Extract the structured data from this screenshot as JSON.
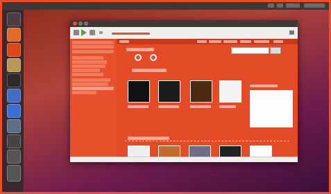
{
  "desktop": {
    "top_bar_title": ""
  },
  "player": {
    "window_title": "",
    "status_text": "",
    "sidebar_items": [
      "",
      "",
      "",
      "",
      "",
      "",
      "",
      "",
      "",
      "",
      "",
      ""
    ],
    "store_heading": "",
    "section_heading": "",
    "latest_heading": "",
    "search_button": "",
    "nav_tabs": [
      "",
      "",
      "",
      "",
      "",
      ""
    ],
    "featured_albums": [
      {
        "caption": ""
      },
      {
        "caption": ""
      },
      {
        "caption": ""
      },
      {
        "caption": ""
      }
    ],
    "chart_entries": [
      "",
      "",
      "",
      "",
      "",
      "",
      "",
      ""
    ],
    "latest_albums": [
      {
        "caption": ""
      },
      {
        "caption": ""
      },
      {
        "caption": ""
      },
      {
        "caption": ""
      },
      {
        "caption": ""
      }
    ]
  },
  "colors": {
    "accent": "#e8502c",
    "panel": "#3c3b37"
  },
  "icons": [
    "home-icon",
    "firefox-icon",
    "ubuntu-one-icon",
    "files-icon",
    "terminal-icon",
    "settings-icon",
    "music-icon",
    "software-center-icon",
    "workspace-icon",
    "trash-icon",
    "play-icon",
    "previous-icon",
    "next-icon",
    "volume-icon",
    "close-icon"
  ]
}
